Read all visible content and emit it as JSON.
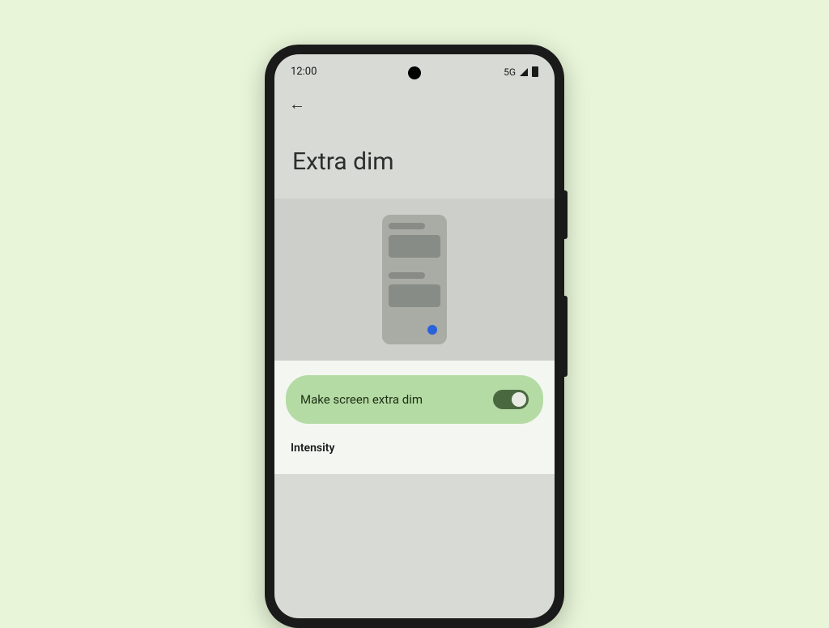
{
  "statusBar": {
    "time": "12:00",
    "network": "5G"
  },
  "header": {
    "title": "Extra dim"
  },
  "settings": {
    "toggle": {
      "label": "Make screen extra dim",
      "enabled": true
    },
    "intensityLabel": "Intensity"
  }
}
